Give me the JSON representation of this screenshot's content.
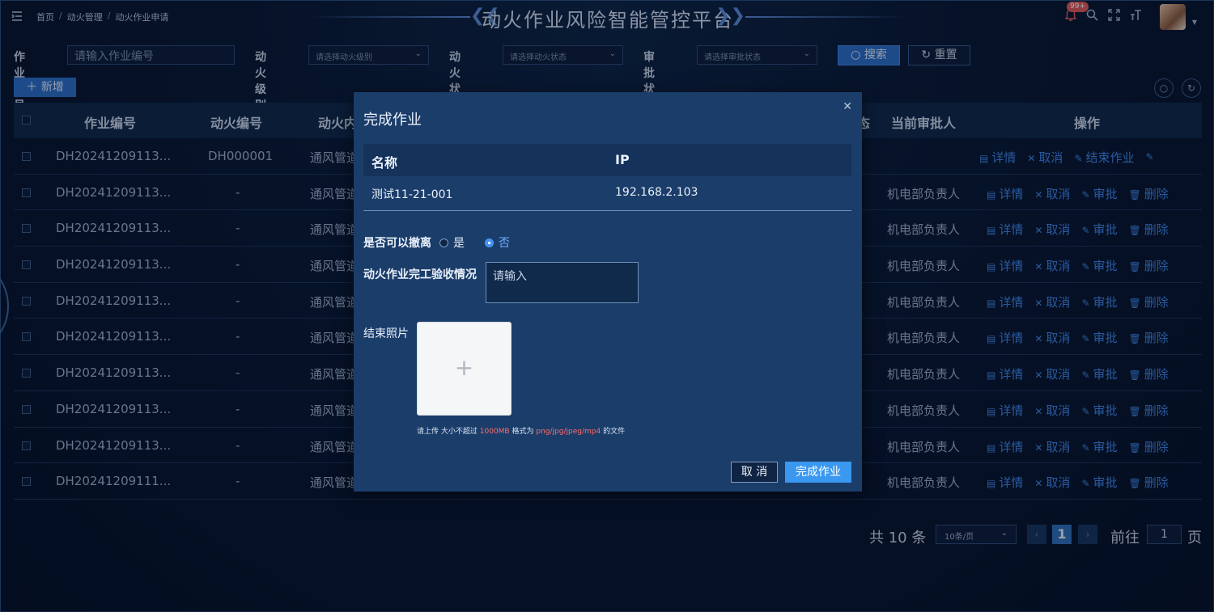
{
  "header": {
    "breadcrumb": [
      "首页",
      "动火管理",
      "动火作业申请"
    ],
    "title": "动火作业风险智能管控平台",
    "badge": "99+"
  },
  "filters": {
    "job_no_label": "作业编号",
    "job_no_placeholder": "请输入作业编号",
    "level_label": "动火级别",
    "level_placeholder": "请选择动火级别",
    "status_label": "动火状态",
    "status_placeholder": "请选择动火状态",
    "approval_label": "审批状态",
    "approval_placeholder": "请选择审批状态",
    "search_label": "搜索",
    "reset_label": "重置"
  },
  "toolbar": {
    "add_label": "新增"
  },
  "table": {
    "headers": {
      "job_no": "作业编号",
      "fire_no": "动火编号",
      "content": "动火内",
      "status_tail": "态",
      "approver": "当前审批人",
      "ops": "操作"
    },
    "rows": [
      {
        "job_no": "DH20241209113...",
        "fire_no": "DH000001",
        "content": "通风管道",
        "approver": "",
        "ops": [
          "详情",
          "取消",
          "结束作业",
          ""
        ]
      },
      {
        "job_no": "DH20241209113...",
        "fire_no": "-",
        "content": "通风管道",
        "approver": "机电部负责人",
        "ops": [
          "详情",
          "取消",
          "审批",
          "删除"
        ]
      },
      {
        "job_no": "DH20241209113...",
        "fire_no": "-",
        "content": "通风管道",
        "approver": "机电部负责人",
        "ops": [
          "详情",
          "取消",
          "审批",
          "删除"
        ]
      },
      {
        "job_no": "DH20241209113...",
        "fire_no": "-",
        "content": "通风管道",
        "approver": "机电部负责人",
        "ops": [
          "详情",
          "取消",
          "审批",
          "删除"
        ]
      },
      {
        "job_no": "DH20241209113...",
        "fire_no": "-",
        "content": "通风管道",
        "approver": "机电部负责人",
        "ops": [
          "详情",
          "取消",
          "审批",
          "删除"
        ]
      },
      {
        "job_no": "DH20241209113...",
        "fire_no": "-",
        "content": "通风管道",
        "approver": "机电部负责人",
        "ops": [
          "详情",
          "取消",
          "审批",
          "删除"
        ]
      },
      {
        "job_no": "DH20241209113...",
        "fire_no": "-",
        "content": "通风管道",
        "approver": "机电部负责人",
        "ops": [
          "详情",
          "取消",
          "审批",
          "删除"
        ]
      },
      {
        "job_no": "DH20241209113...",
        "fire_no": "-",
        "content": "通风管道",
        "approver": "机电部负责人",
        "ops": [
          "详情",
          "取消",
          "审批",
          "删除"
        ]
      },
      {
        "job_no": "DH20241209113...",
        "fire_no": "-",
        "content": "通风管道",
        "approver": "机电部负责人",
        "ops": [
          "详情",
          "取消",
          "审批",
          "删除"
        ]
      },
      {
        "job_no": "DH20241209111...",
        "fire_no": "-",
        "content": "通风管道",
        "approver": "机电部负责人",
        "ops": [
          "详情",
          "取消",
          "审批",
          "删除"
        ]
      }
    ]
  },
  "pagination": {
    "total": "共 10 条",
    "page_size": "10条/页",
    "current_page": "1",
    "goto_label": "前往",
    "goto_value": "1",
    "page_suffix": "页"
  },
  "modal": {
    "title": "完成作业",
    "table_headers": [
      "名称",
      "IP"
    ],
    "table_rows": [
      [
        "测试11-21-001",
        "192.168.2.103"
      ]
    ],
    "evacuate_label": "是否可以撤离",
    "yes_label": "是",
    "no_label": "否",
    "selected": "否",
    "acceptance_label": "动火作业完工验收情况",
    "acceptance_placeholder": "请输入",
    "photo_label": "结束照片",
    "tip_prefix": "请上传 大小不超过",
    "tip_size": "1000MB",
    "tip_mid": "格式为",
    "tip_formats": "png/jpg/jpeg/mp4",
    "tip_suffix": "的文件",
    "cancel_label": "取 消",
    "finish_label": "完成作业"
  }
}
